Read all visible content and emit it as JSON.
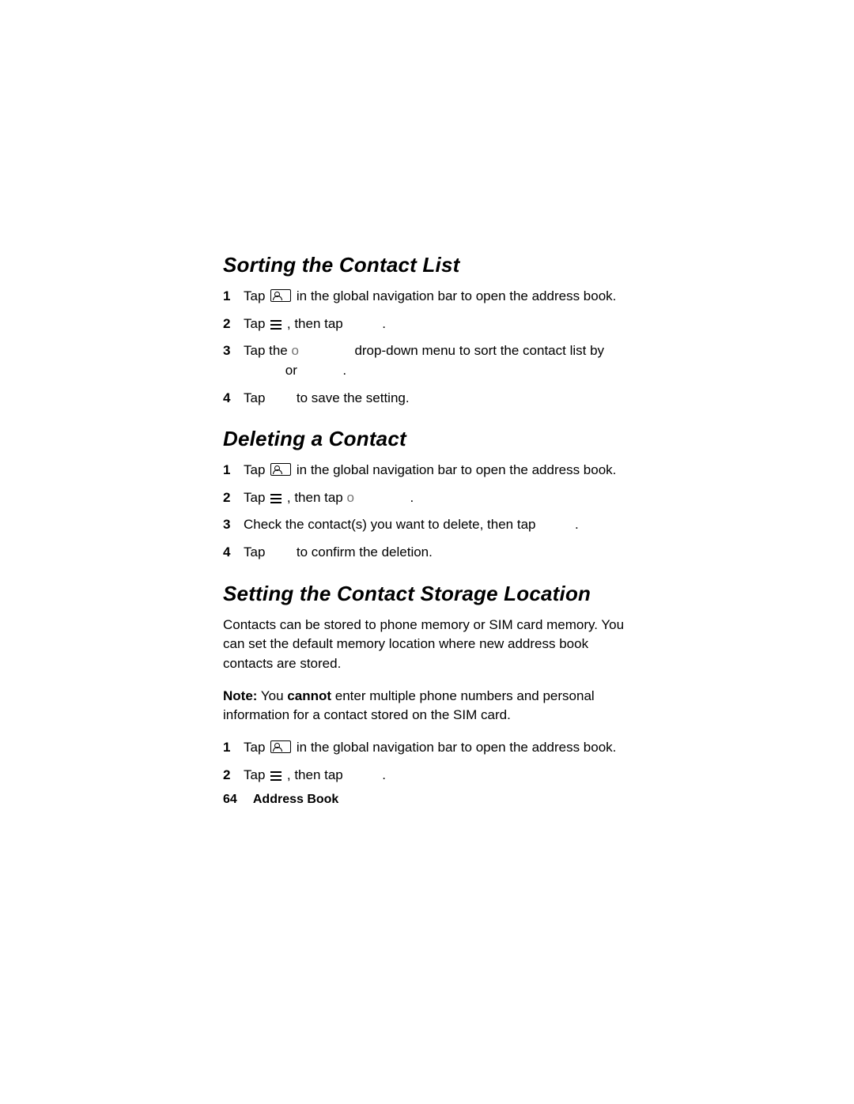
{
  "sections": {
    "sorting": {
      "heading": "Sorting the Contact List",
      "step1_a": "Tap ",
      "step1_b": " in the global navigation bar to open the address book.",
      "step2_a": "Tap ",
      "step2_b": " , then tap ",
      "step2_c": ".",
      "step3_a": "Tap the ",
      "step3_b": " drop-down menu to sort the contact list by ",
      "step3_c": " or ",
      "step3_d": ".",
      "step4_a": "Tap ",
      "step4_b": " to save the setting."
    },
    "deleting": {
      "heading": "Deleting a Contact",
      "step1_a": "Tap ",
      "step1_b": " in the global navigation bar to open the address book.",
      "step2_a": "Tap ",
      "step2_b": " , then tap  ",
      "step2_c": ".",
      "step3_a": "Check the contact(s) you want to delete, then tap ",
      "step3_b": ".",
      "step4_a": "Tap ",
      "step4_b": " to confirm the deletion."
    },
    "storage": {
      "heading": "Setting the Contact Storage Location",
      "para1": "Contacts can be stored to phone memory or SIM card memory. You can set the default memory location where new address book contacts are stored.",
      "note_label": "Note:",
      "note_mid_a": " You ",
      "note_bold": "cannot",
      "note_mid_b": " enter multiple phone numbers and personal information for a contact stored on the SIM card.",
      "step1_a": "Tap ",
      "step1_b": " in the global navigation bar to open the address book.",
      "step2_a": "Tap ",
      "step2_b": " , then tap ",
      "step2_c": "."
    }
  },
  "faded": {
    "o_token": "o"
  },
  "footer": {
    "page_num": "64",
    "title": "Address Book"
  },
  "nums": {
    "n1": "1",
    "n2": "2",
    "n3": "3",
    "n4": "4"
  }
}
